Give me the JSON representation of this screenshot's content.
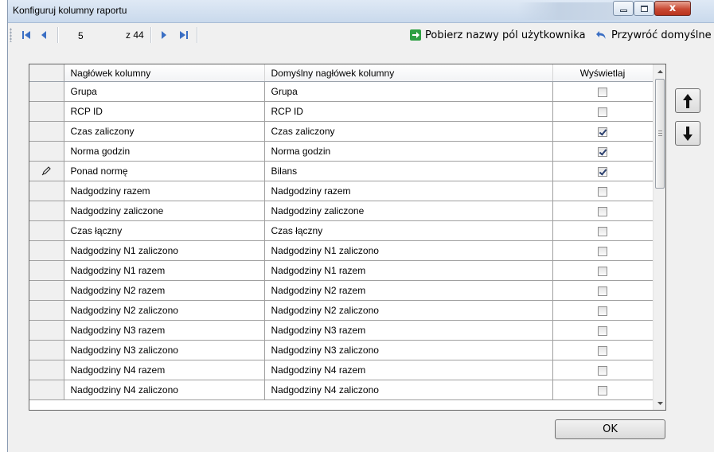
{
  "window": {
    "title": "Konfiguruj kolumny raportu",
    "controls": {
      "minimize": "minimize",
      "maximize": "maximize",
      "close": "x"
    }
  },
  "toolbar": {
    "current_page": "5",
    "page_total": "z 44",
    "fetch_names_label": "Pobierz nazwy pól użytkownika",
    "restore_defaults_label": "Przywróć domyślne"
  },
  "grid": {
    "columns": [
      "Nagłówek kolumny",
      "Domyślny nagłówek kolumny",
      "Wyświetlaj"
    ],
    "rows": [
      {
        "header": "Grupa",
        "default": "Grupa",
        "show": false
      },
      {
        "header": "RCP ID",
        "default": "RCP ID",
        "show": false
      },
      {
        "header": "Czas zaliczony",
        "default": "Czas zaliczony",
        "show": true
      },
      {
        "header": "Norma godzin",
        "default": "Norma godzin",
        "show": true
      },
      {
        "header": "Ponad normę",
        "default": "Bilans",
        "show": true,
        "editing": true
      },
      {
        "header": "Nadgodziny razem",
        "default": "Nadgodziny razem",
        "show": false
      },
      {
        "header": "Nadgodziny zaliczone",
        "default": "Nadgodziny zaliczone",
        "show": false
      },
      {
        "header": "Czas łączny",
        "default": "Czas łączny",
        "show": false
      },
      {
        "header": "Nadgodziny N1 zaliczono",
        "default": "Nadgodziny N1 zaliczono",
        "show": false
      },
      {
        "header": "Nadgodziny N1 razem",
        "default": "Nadgodziny N1 razem",
        "show": false
      },
      {
        "header": "Nadgodziny N2 razem",
        "default": "Nadgodziny N2 razem",
        "show": false
      },
      {
        "header": "Nadgodziny N2 zaliczono",
        "default": "Nadgodziny N2 zaliczono",
        "show": false
      },
      {
        "header": "Nadgodziny N3 razem",
        "default": "Nadgodziny N3 razem",
        "show": false
      },
      {
        "header": "Nadgodziny N3 zaliczono",
        "default": "Nadgodziny N3 zaliczono",
        "show": false
      },
      {
        "header": "Nadgodziny N4 razem",
        "default": "Nadgodziny N4 razem",
        "show": false
      },
      {
        "header": "Nadgodziny N4 zaliczono",
        "default": "Nadgodziny N4 zaliczono",
        "show": false
      }
    ]
  },
  "buttons": {
    "ok": "OK"
  },
  "icons": {
    "first": "first-page-icon",
    "prev": "prev-page-icon",
    "next": "next-page-icon",
    "last": "last-page-icon",
    "fetch": "green-arrow-icon",
    "restore": "undo-arrow-icon",
    "up": "move-up-icon",
    "down": "move-down-icon",
    "edit": "pencil-icon"
  },
  "colors": {
    "nav_blue": "#3b6fc4",
    "fetch_green": "#2ea043",
    "title_gradient": "#dfe9f5",
    "close_red": "#c94a34"
  }
}
